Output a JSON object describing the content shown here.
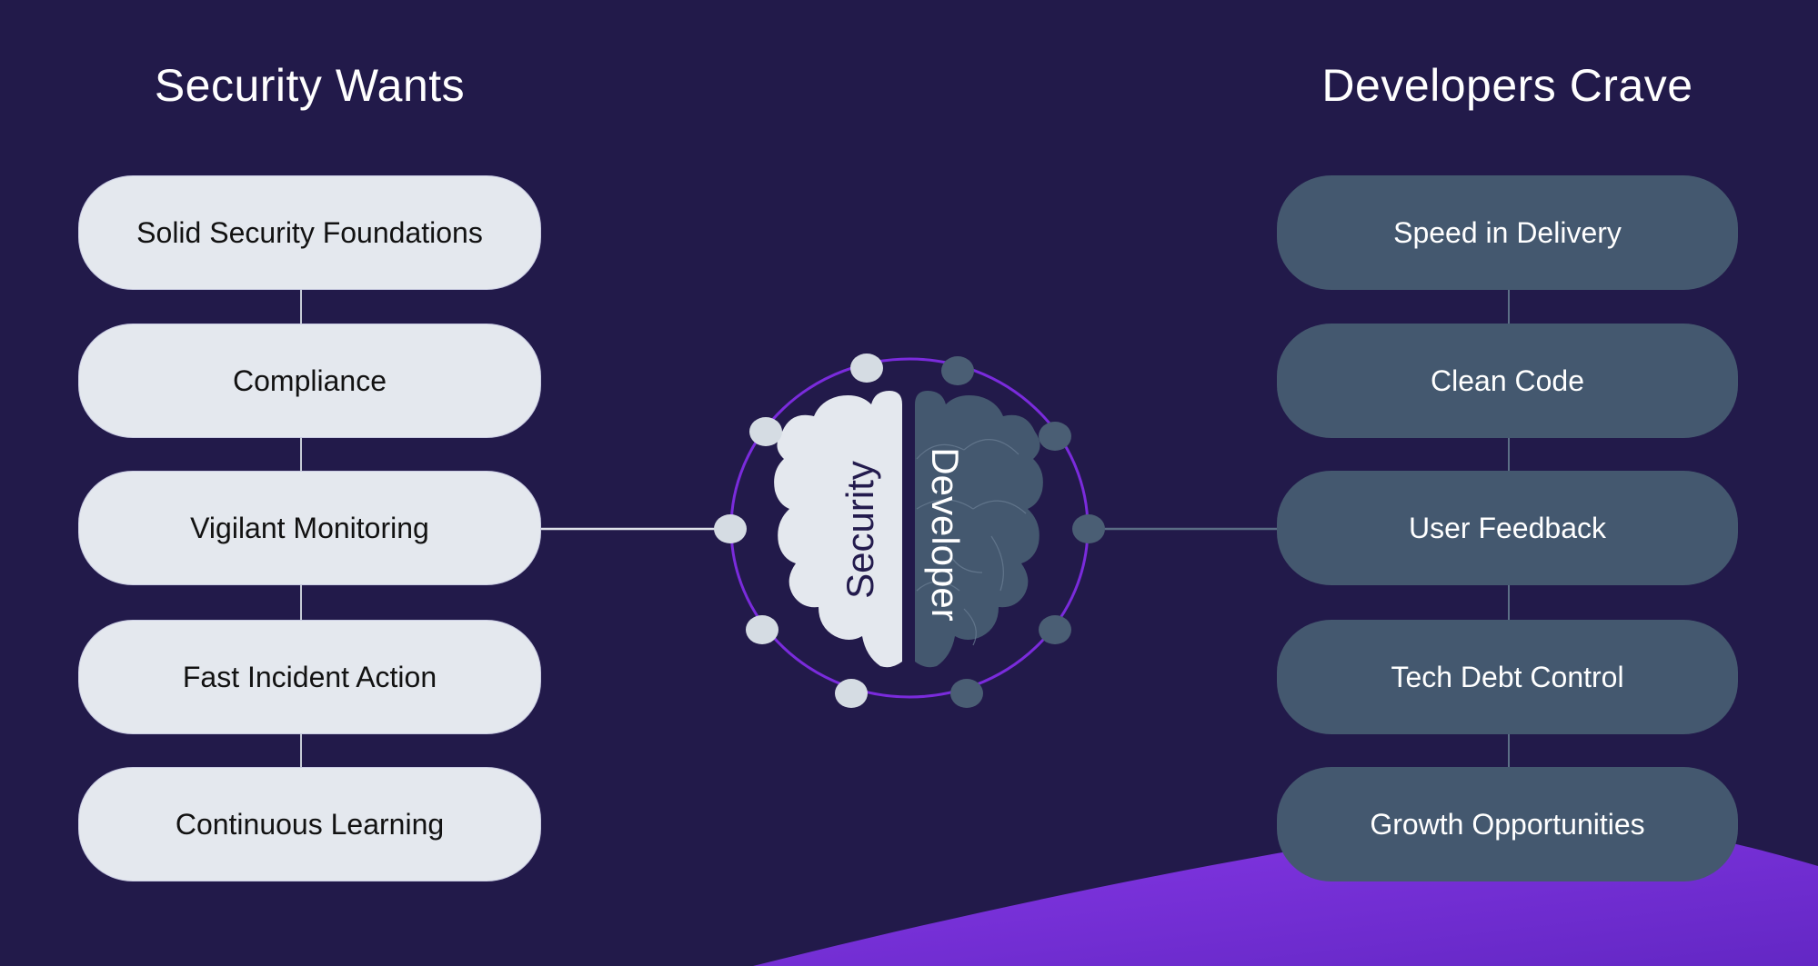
{
  "colors": {
    "background": "#221a4a",
    "accent_purple": "#7a2bdc",
    "security_fill": "#e4e8ee",
    "developer_fill": "#44586f",
    "security_text": "#121212",
    "developer_text": "#ffffff"
  },
  "left": {
    "title": "Security Wants",
    "items": [
      "Solid Security Foundations",
      "Compliance",
      "Vigilant Monitoring",
      "Fast Incident Action",
      "Continuous Learning"
    ]
  },
  "right": {
    "title": "Developers Crave",
    "items": [
      "Speed in Delivery",
      "Clean Code",
      "User Feedback",
      "Tech Debt Control",
      "Growth Opportunities"
    ]
  },
  "center": {
    "left_label": "Security",
    "right_label": "Developer",
    "icon": "split-brain-icon"
  }
}
